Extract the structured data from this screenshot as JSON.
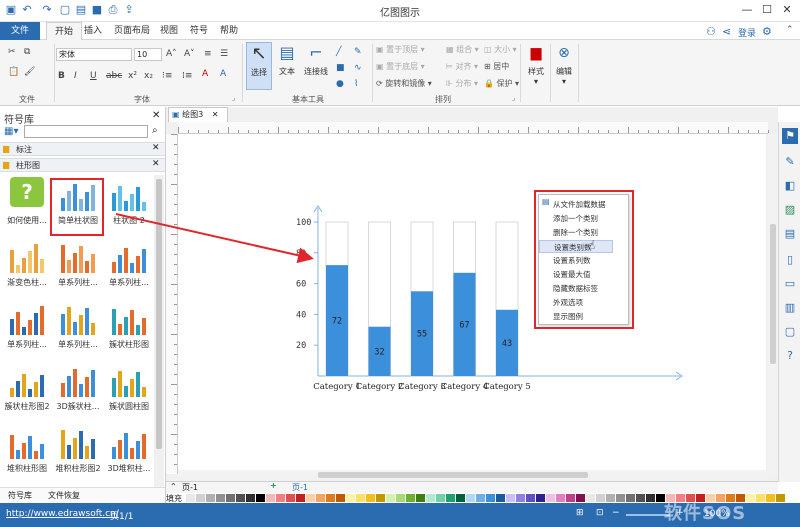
{
  "app": {
    "title": "亿图图示",
    "login": "登录",
    "window_controls": [
      "—",
      "☐",
      "✕"
    ]
  },
  "menu_tabs": [
    {
      "label": "文件"
    },
    {
      "label": "开始"
    },
    {
      "label": "插入"
    },
    {
      "label": "页面布局"
    },
    {
      "label": "视图"
    },
    {
      "label": "符号"
    },
    {
      "label": "帮助"
    }
  ],
  "ribbon": {
    "file_group_label": "文件",
    "font_group_label": "字体",
    "font_name": "宋体",
    "font_size": "10",
    "basic_tools_label": "基本工具",
    "select_label": "选择",
    "text_label": "文本",
    "connector_label": "连接线",
    "arrange_label": "排列",
    "bring_front": "置于顶层",
    "send_back": "置于底层",
    "rotate_mirror": "旋转和镜像",
    "group": "组合",
    "align": "对齐",
    "distribute": "分布",
    "size": "大小",
    "center": "居中",
    "protect": "保护",
    "style_label": "样式",
    "edit_label": "编辑"
  },
  "sidebar": {
    "title": "符号库",
    "section_annotation": "标注",
    "section_bar": "柱形图",
    "items": [
      {
        "label": "如何使用..."
      },
      {
        "label": "简单柱状图"
      },
      {
        "label": "柱状图 2"
      },
      {
        "label": "渐变色柱..."
      },
      {
        "label": "单系列柱..."
      },
      {
        "label": "单系列柱..."
      },
      {
        "label": "单系列柱..."
      },
      {
        "label": "单系列柱..."
      },
      {
        "label": "簇状柱形图"
      },
      {
        "label": "簇状柱形图2"
      },
      {
        "label": "3D簇状柱..."
      },
      {
        "label": "簇状圆柱图"
      },
      {
        "label": "堆积柱形图"
      },
      {
        "label": "堆积柱形图2"
      },
      {
        "label": "3D堆积柱..."
      },
      {
        "label": "符号库"
      },
      {
        "label": "文件恢复"
      }
    ]
  },
  "document": {
    "tab_label": "绘图3",
    "page_label": "页-1",
    "page_tab": "页-1",
    "fill_label": "填充"
  },
  "context_menu": {
    "items": [
      {
        "label": "从文件加载数据"
      },
      {
        "label": "添加一个类别"
      },
      {
        "label": "删除一个类别"
      },
      {
        "label": "设置类别数"
      },
      {
        "label": "设置系列数"
      },
      {
        "label": "设置最大值"
      },
      {
        "label": "隐藏数据标签"
      },
      {
        "label": "外观选项"
      },
      {
        "label": "显示图例"
      }
    ],
    "highlighted_index": 3
  },
  "chart_data": {
    "type": "bar",
    "categories": [
      "Category 1",
      "Category 2",
      "Category 3",
      "Category 4",
      "Category 5"
    ],
    "values": [
      72,
      32,
      55,
      67,
      43
    ],
    "max": 100,
    "ylim": [
      0,
      100
    ],
    "yticks": [
      20,
      40,
      60,
      80,
      100
    ],
    "bar_color": "#3c8fdb",
    "background_bar_color": "#ffffff",
    "axis_color": "#7fb3e0"
  },
  "status": {
    "url": "http://www.edrawsoft.cn/",
    "page_info": "页1/1",
    "zoom": "100%",
    "watermark": "软件SOS"
  },
  "colors": {
    "accent": "#2b6cb0",
    "highlight_box": "#e0262b"
  }
}
